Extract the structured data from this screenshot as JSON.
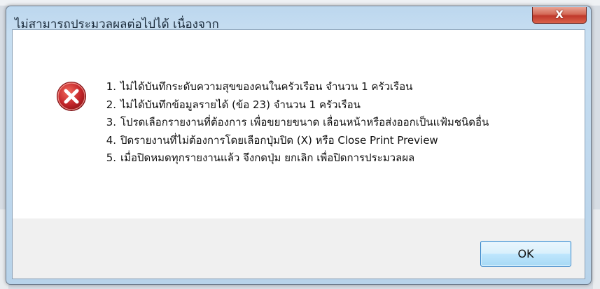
{
  "dialog": {
    "title": "ไม่สามารถประมวลผลต่อไปได้ เนื่องจาก",
    "close_symbol": "X",
    "icon": "error-icon",
    "messages": [
      {
        "num": "1.",
        "text": "ไม่ได้บันทึกระดับความสุขของคนในครัวเรือน จำนวน  1 ครัวเรือน"
      },
      {
        "num": "2.",
        "text": "ไม่ได้บันทึกข้อมูลรายได้ (ข้อ 23) จำนวน  1 ครัวเรือน"
      },
      {
        "num": "3.",
        "text": "โปรดเลือกรายงานที่ต้องการ เพื่อขยายขนาด เลื่อนหน้าหรือส่งออกเป็นแฟ้มชนิดอื่น"
      },
      {
        "num": "4.",
        "text": "ปิดรายงานที่ไม่ต้องการโดยเลือกปุ่มปิด (X) หรือ Close Print Preview"
      },
      {
        "num": "5.",
        "text": "เมื่อปิดหมดทุกรายงานแล้ว จึงกดปุ่ม ยกเลิก เพื่อปิดการประมวลผล"
      }
    ],
    "ok_label": "OK"
  },
  "colors": {
    "title_bar": "#c2daef",
    "close_button": "#c0392b",
    "error_icon": "#c4272b",
    "ok_border": "#2f82c9"
  }
}
